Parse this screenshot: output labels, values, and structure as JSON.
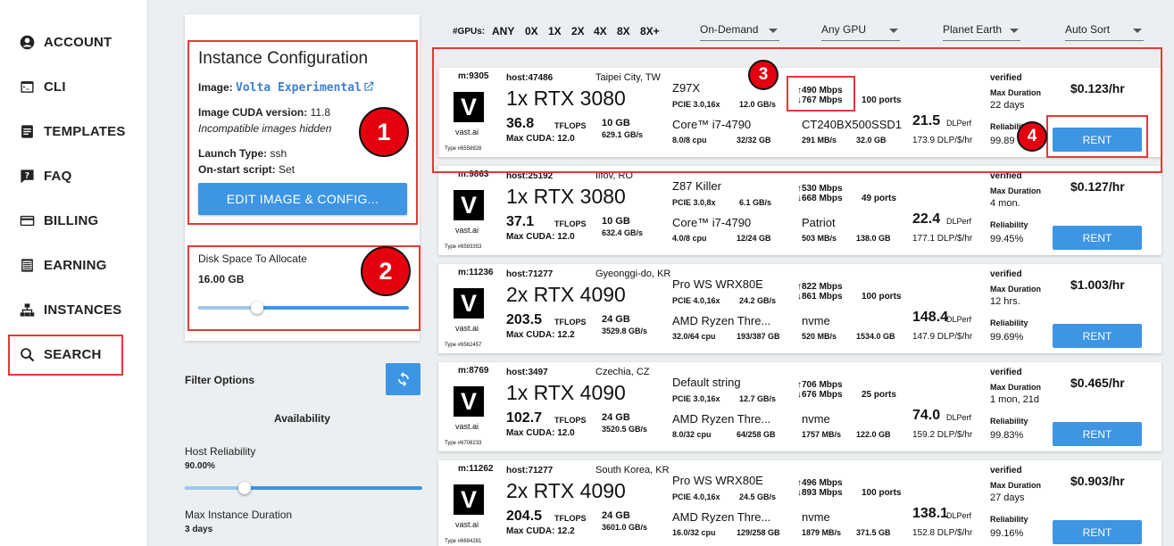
{
  "sidebar": {
    "items": [
      {
        "label": "ACCOUNT",
        "icon": "account-icon"
      },
      {
        "label": "CLI",
        "icon": "terminal-icon"
      },
      {
        "label": "TEMPLATES",
        "icon": "document-icon"
      },
      {
        "label": "FAQ",
        "icon": "help-icon"
      },
      {
        "label": "BILLING",
        "icon": "credit-card-icon"
      },
      {
        "label": "EARNING",
        "icon": "list-icon"
      },
      {
        "label": "INSTANCES",
        "icon": "hierarchy-icon"
      },
      {
        "label": "SEARCH",
        "icon": "search-icon"
      }
    ]
  },
  "config": {
    "title": "Instance Configuration",
    "image_label": "Image:",
    "image_value": "Volta Experimental",
    "cuda_label": "Image CUDA version:",
    "cuda_value": "11.8",
    "incompatible": "Incompatible images hidden",
    "launch_label": "Launch Type:",
    "launch_value": "ssh",
    "onstart_label": "On-start script:",
    "onstart_value": "Set",
    "edit_button": "EDIT IMAGE & CONFIG..."
  },
  "disk": {
    "label": "Disk Space To Allocate",
    "value": "16.00 GB",
    "level": 0.28
  },
  "filter": {
    "title": "Filter Options",
    "availability": "Availability",
    "reliability_label": "Host Reliability",
    "reliability_value": "90.00%",
    "reliability_level": 0.25,
    "duration_label": "Max Instance Duration",
    "duration_value": "3 days"
  },
  "annotations": [
    "1",
    "2",
    "3",
    "4"
  ],
  "gpu_filter": {
    "label": "#GPUs:",
    "options": [
      "ANY",
      "0X",
      "1X",
      "2X",
      "4X",
      "8X",
      "8X+"
    ]
  },
  "dropdowns": [
    "On-Demand",
    "Any GPU",
    "Planet Earth",
    "Auto Sort"
  ],
  "labels": {
    "tflops": "TFLOPS",
    "dlperf": "DLPerf",
    "verified": "verified",
    "max_duration": "Max Duration",
    "reliability": "Reliability",
    "rent": "RENT",
    "logo_letter": "V",
    "logo_text": "vast.ai"
  },
  "offers": [
    {
      "machine": "m:9305",
      "host": "host:47486",
      "location": "Taipei City, TW",
      "gpu": "1x RTX 3080",
      "tflops": "36.8",
      "max_cuda": "Max CUDA: 12.0",
      "vram": "10 GB",
      "vram_bw": "629.1 GB/s",
      "type_id": "Type #6558928",
      "mobo": "Z97X",
      "pcie": "PCIE 3.0,16x",
      "pcie_bw": "12.0 GB/s",
      "cpu": "Core™ i7-4790",
      "cpu_cores": "8.0/8 cpu",
      "ram": "32/32 GB",
      "up": "490 Mbps",
      "down": "767 Mbps",
      "ports": "100 ports",
      "disk": "CT240BX500SSD1",
      "disk_speed": "291 MB/s",
      "disk_size": "32.0 GB",
      "dlperf": "21.5",
      "dlperf_per": "173.9 DLP/$/hr",
      "duration": "22 days",
      "reliability": "99.89",
      "price": "$0.123/hr"
    },
    {
      "machine": "m:9863",
      "host": "host:25192",
      "location": "Ilfov, RO",
      "gpu": "1x RTX 3080",
      "tflops": "37.1",
      "max_cuda": "Max CUDA: 12.0",
      "vram": "10 GB",
      "vram_bw": "632.4 GB/s",
      "type_id": "Type #6593353",
      "mobo": "Z87 Killer",
      "pcie": "PCIE 3.0,8x",
      "pcie_bw": "6.1 GB/s",
      "cpu": "Core™ i7-4790",
      "cpu_cores": "4.0/8 cpu",
      "ram": "12/24 GB",
      "up": "530 Mbps",
      "down": "668 Mbps",
      "ports": "49 ports",
      "disk": "Patriot",
      "disk_speed": "503 MB/s",
      "disk_size": "138.0 GB",
      "dlperf": "22.4",
      "dlperf_per": "177.1 DLP/$/hr",
      "duration": "4 mon.",
      "reliability": "99.45%",
      "price": "$0.127/hr"
    },
    {
      "machine": "m:11236",
      "host": "host:71277",
      "location": "Gyeonggi-do, KR",
      "gpu": "2x RTX 4090",
      "tflops": "203.5",
      "max_cuda": "Max CUDA: 12.2",
      "vram": "24 GB",
      "vram_bw": "3529.8 GB/s",
      "type_id": "Type #6562457",
      "mobo": "Pro WS WRX80E",
      "pcie": "PCIE 4.0,16x",
      "pcie_bw": "24.2 GB/s",
      "cpu": "AMD Ryzen Thre...",
      "cpu_cores": "32.0/64 cpu",
      "ram": "193/387 GB",
      "up": "822 Mbps",
      "down": "861 Mbps",
      "ports": "100 ports",
      "disk": "nvme",
      "disk_speed": "520 MB/s",
      "disk_size": "1534.0 GB",
      "dlperf": "148.4",
      "dlperf_per": "147.9 DLP/$/hr",
      "duration": "12 hrs.",
      "reliability": "99.69%",
      "price": "$1.003/hr"
    },
    {
      "machine": "m:8769",
      "host": "host:3497",
      "location": "Czechia, CZ",
      "gpu": "1x RTX 4090",
      "tflops": "102.7",
      "max_cuda": "Max CUDA: 12.0",
      "vram": "24 GB",
      "vram_bw": "3520.5 GB/s",
      "type_id": "Type #6708233",
      "mobo": "Default string",
      "pcie": "PCIE 3.0,16x",
      "pcie_bw": "12.7 GB/s",
      "cpu": "AMD Ryzen Thre...",
      "cpu_cores": "8.0/32 cpu",
      "ram": "64/258 GB",
      "up": "706 Mbps",
      "down": "676 Mbps",
      "ports": "25 ports",
      "disk": "nvme",
      "disk_speed": "1757 MB/s",
      "disk_size": "122.0 GB",
      "dlperf": "74.0",
      "dlperf_per": "159.2 DLP/$/hr",
      "duration": "1 mon, 21d",
      "reliability": "99.83%",
      "price": "$0.465/hr"
    },
    {
      "machine": "m:11262",
      "host": "host:71277",
      "location": "South Korea, KR",
      "gpu": "2x RTX 4090",
      "tflops": "204.5",
      "max_cuda": "Max CUDA: 12.2",
      "vram": "24 GB",
      "vram_bw": "3601.0 GB/s",
      "type_id": "Type #6694281",
      "mobo": "Pro WS WRX80E",
      "pcie": "PCIE 4.0,16x",
      "pcie_bw": "24.5 GB/s",
      "cpu": "AMD Ryzen Thre...",
      "cpu_cores": "16.0/32 cpu",
      "ram": "129/258 GB",
      "up": "496 Mbps",
      "down": "893 Mbps",
      "ports": "100 ports",
      "disk": "nvme",
      "disk_speed": "1879 MB/s",
      "disk_size": "371.5 GB",
      "dlperf": "138.1",
      "dlperf_per": "152.8 DLP/$/hr",
      "duration": "27 days",
      "reliability": "99.16%",
      "price": "$0.903/hr"
    }
  ]
}
